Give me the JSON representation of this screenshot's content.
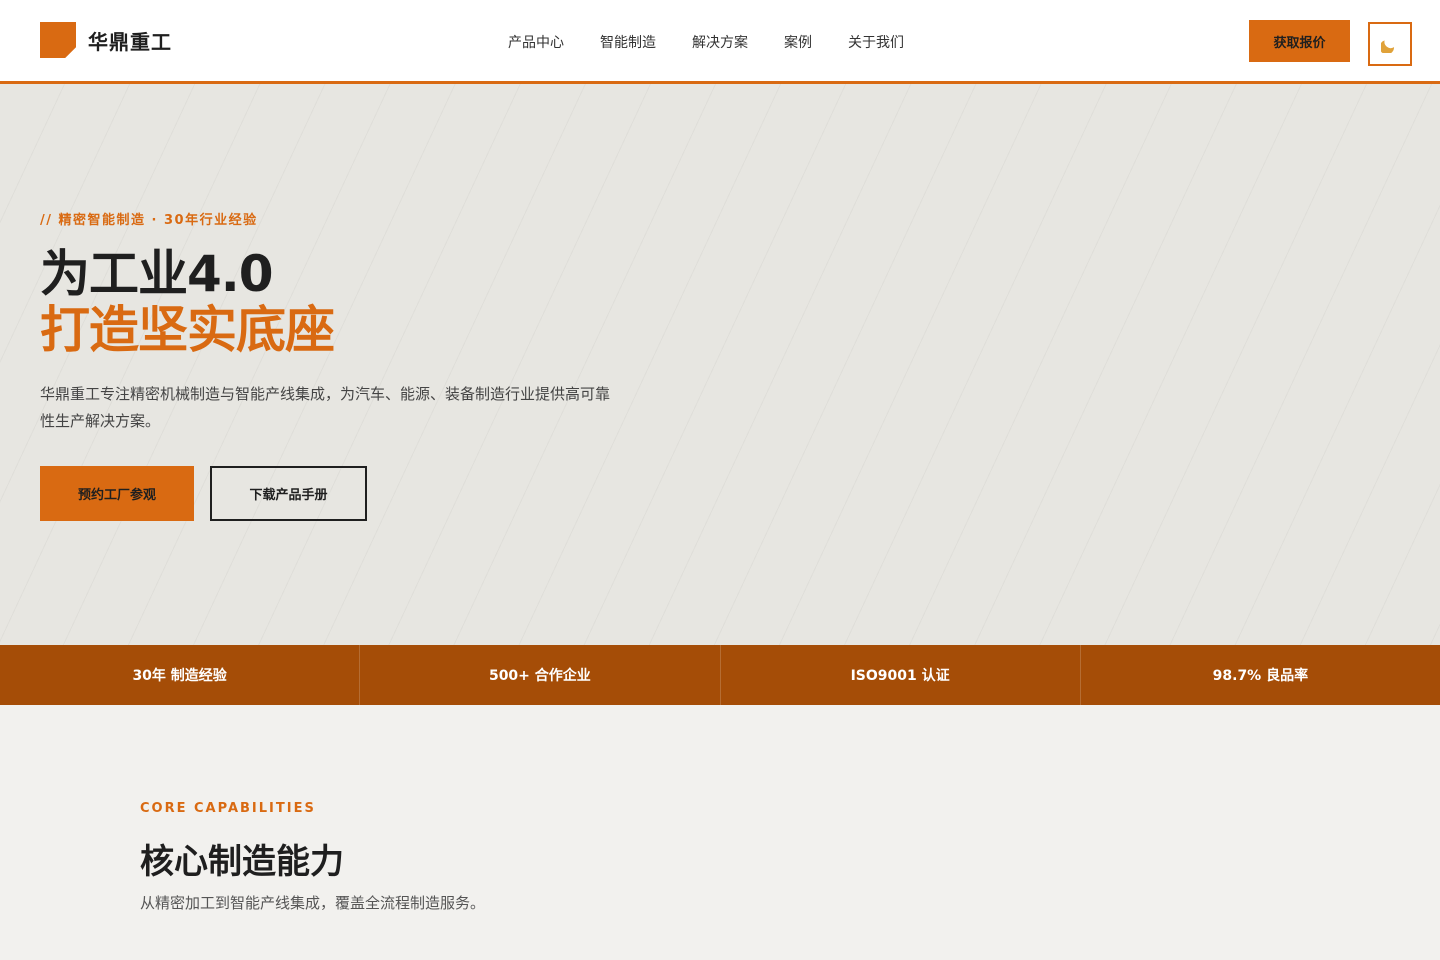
{
  "header": {
    "brand": "华鼎重工",
    "nav": [
      "产品中心",
      "智能制造",
      "解决方案",
      "案例",
      "关于我们"
    ],
    "cta_label": "获取报价",
    "theme_icon": "moon-icon"
  },
  "hero": {
    "eyebrow": "// 精密智能制造 · 30年行业经验",
    "title_line1": "为工业4.0",
    "title_line2": "打造坚实底座",
    "description": "华鼎重工专注精密机械制造与智能产线集成，为汽车、能源、装备制造行业提供高可靠性生产解决方案。",
    "primary_button": "预约工厂参观",
    "secondary_button": "下载产品手册"
  },
  "stats": [
    "30年 制造经验",
    "500+ 合作企业",
    "ISO9001 认证",
    "98.7% 良品率"
  ],
  "capabilities": {
    "eyebrow": "CORE CAPABILITIES",
    "title": "核心制造能力",
    "description": "从精密加工到智能产线集成，覆盖全流程制造服务。"
  },
  "colors": {
    "accent": "#d96a12",
    "stats_bar": "#a54d07",
    "hero_bg": "#e7e6e1",
    "page_bg": "#f2f1ee",
    "text_dark": "#1f1f1f"
  }
}
